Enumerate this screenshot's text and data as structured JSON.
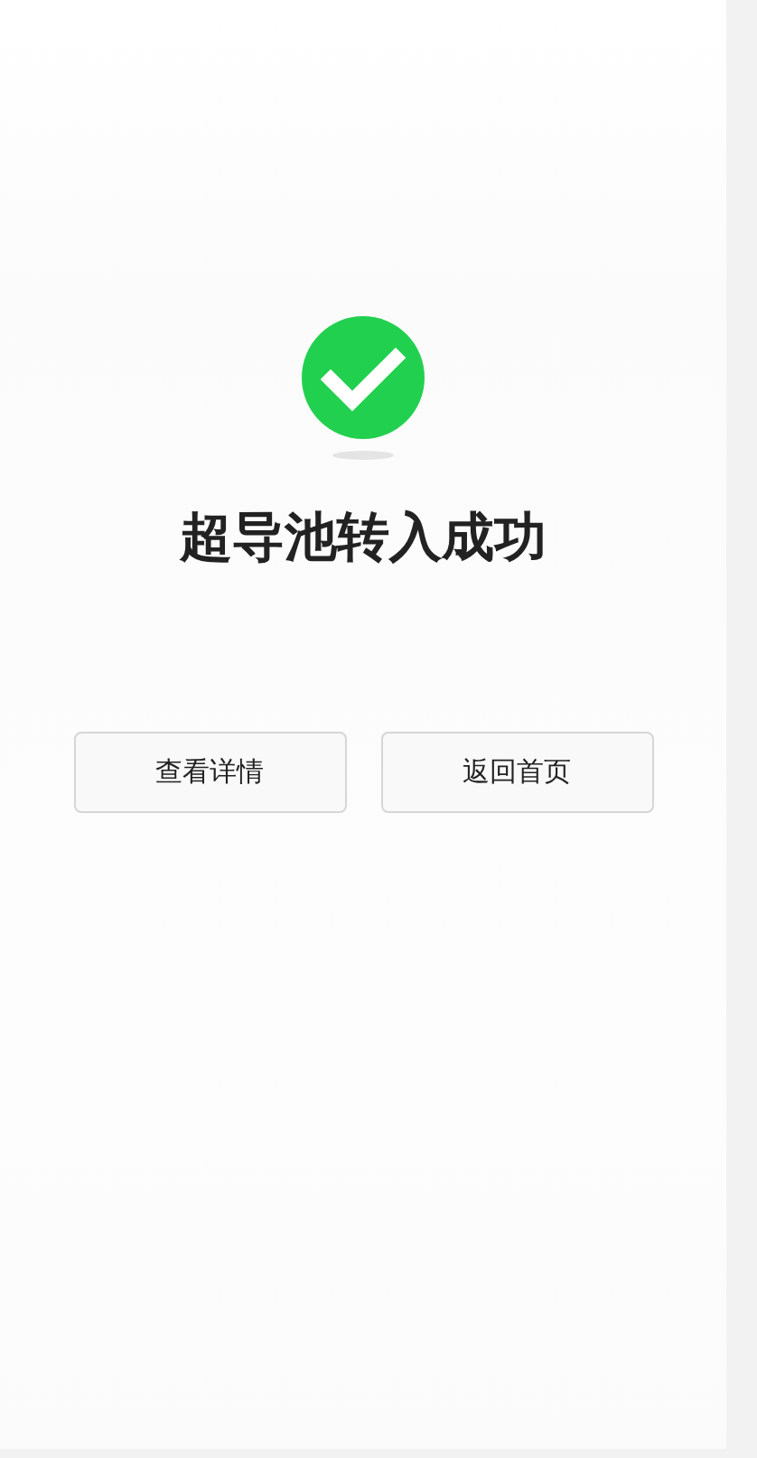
{
  "result": {
    "kind": "success",
    "title": "超导池转入成功"
  },
  "buttons": [
    {
      "label": "查看详情"
    },
    {
      "label": "返回首页"
    }
  ]
}
